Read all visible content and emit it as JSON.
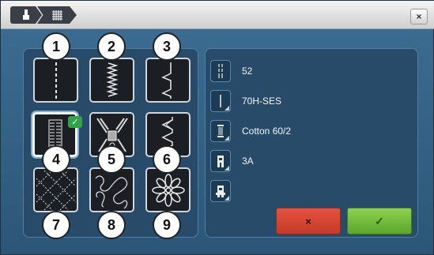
{
  "titlebar": {
    "crumbs": [
      {
        "icon": "presser-foot-icon"
      },
      {
        "icon": "grid-icon"
      }
    ],
    "close_label": "×"
  },
  "stitch_grid": {
    "tiles": [
      {
        "number": "1",
        "icon": "straight-stitch-icon",
        "selected": false
      },
      {
        "number": "2",
        "icon": "zigzag-stitch-icon",
        "selected": false
      },
      {
        "number": "3",
        "icon": "blind-stitch-icon",
        "selected": false
      },
      {
        "number": "4",
        "icon": "buttonhole-icon",
        "selected": true
      },
      {
        "number": "5",
        "icon": "zipper-icon",
        "selected": false
      },
      {
        "number": "6",
        "icon": "decorative-stitch-icon",
        "selected": false
      },
      {
        "number": "7",
        "icon": "quilting-grid-icon",
        "selected": false
      },
      {
        "number": "8",
        "icon": "stipple-icon",
        "selected": false
      },
      {
        "number": "9",
        "icon": "flower-icon",
        "selected": false
      }
    ]
  },
  "info": {
    "rows": [
      {
        "icon": "stitch-length-icon",
        "value": "52"
      },
      {
        "icon": "needle-icon",
        "value": "70H-SES"
      },
      {
        "icon": "thread-spool-icon",
        "value": "Cotton 60/2"
      },
      {
        "icon": "presser-foot-icon",
        "value": "3A"
      },
      {
        "icon": "presser-foot-alt-icon",
        "value": ""
      }
    ]
  },
  "actions": {
    "cancel_label": "×",
    "confirm_label": "✓"
  },
  "colors": {
    "background": "#2f5b7c",
    "cancel": "#d9432f",
    "confirm": "#7dc243",
    "selected_badge": "#2ea34a"
  }
}
